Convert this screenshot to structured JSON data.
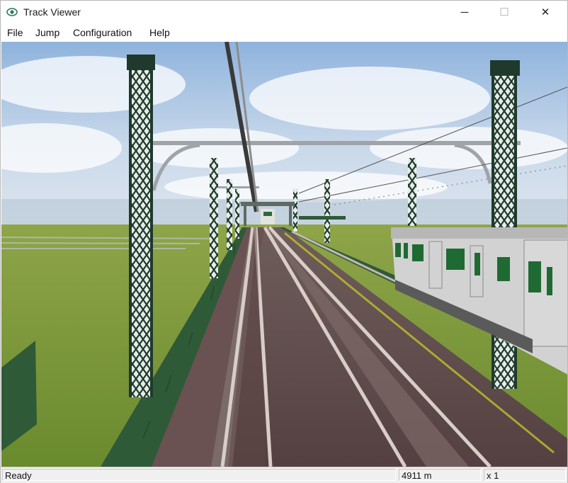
{
  "window": {
    "title": "Track Viewer",
    "app_icon": "eye-icon"
  },
  "controls": {
    "minimize": "─",
    "maximize": "☐",
    "close": "✕"
  },
  "menu": {
    "items": [
      "File",
      "Jump",
      "Configuration",
      "Help"
    ]
  },
  "status": {
    "text": "Ready",
    "distance": "4911 m",
    "speed": "x 1"
  },
  "colors": {
    "sky": "#a9c6e4",
    "grass": "#7f9a3c",
    "fence": "#2f5a38",
    "mast": "#1f3a2c",
    "rail": "#c7b6b0",
    "ballast": "#5f4a48",
    "train_body": "#c8c8c8",
    "train_window": "#1f6a32"
  }
}
